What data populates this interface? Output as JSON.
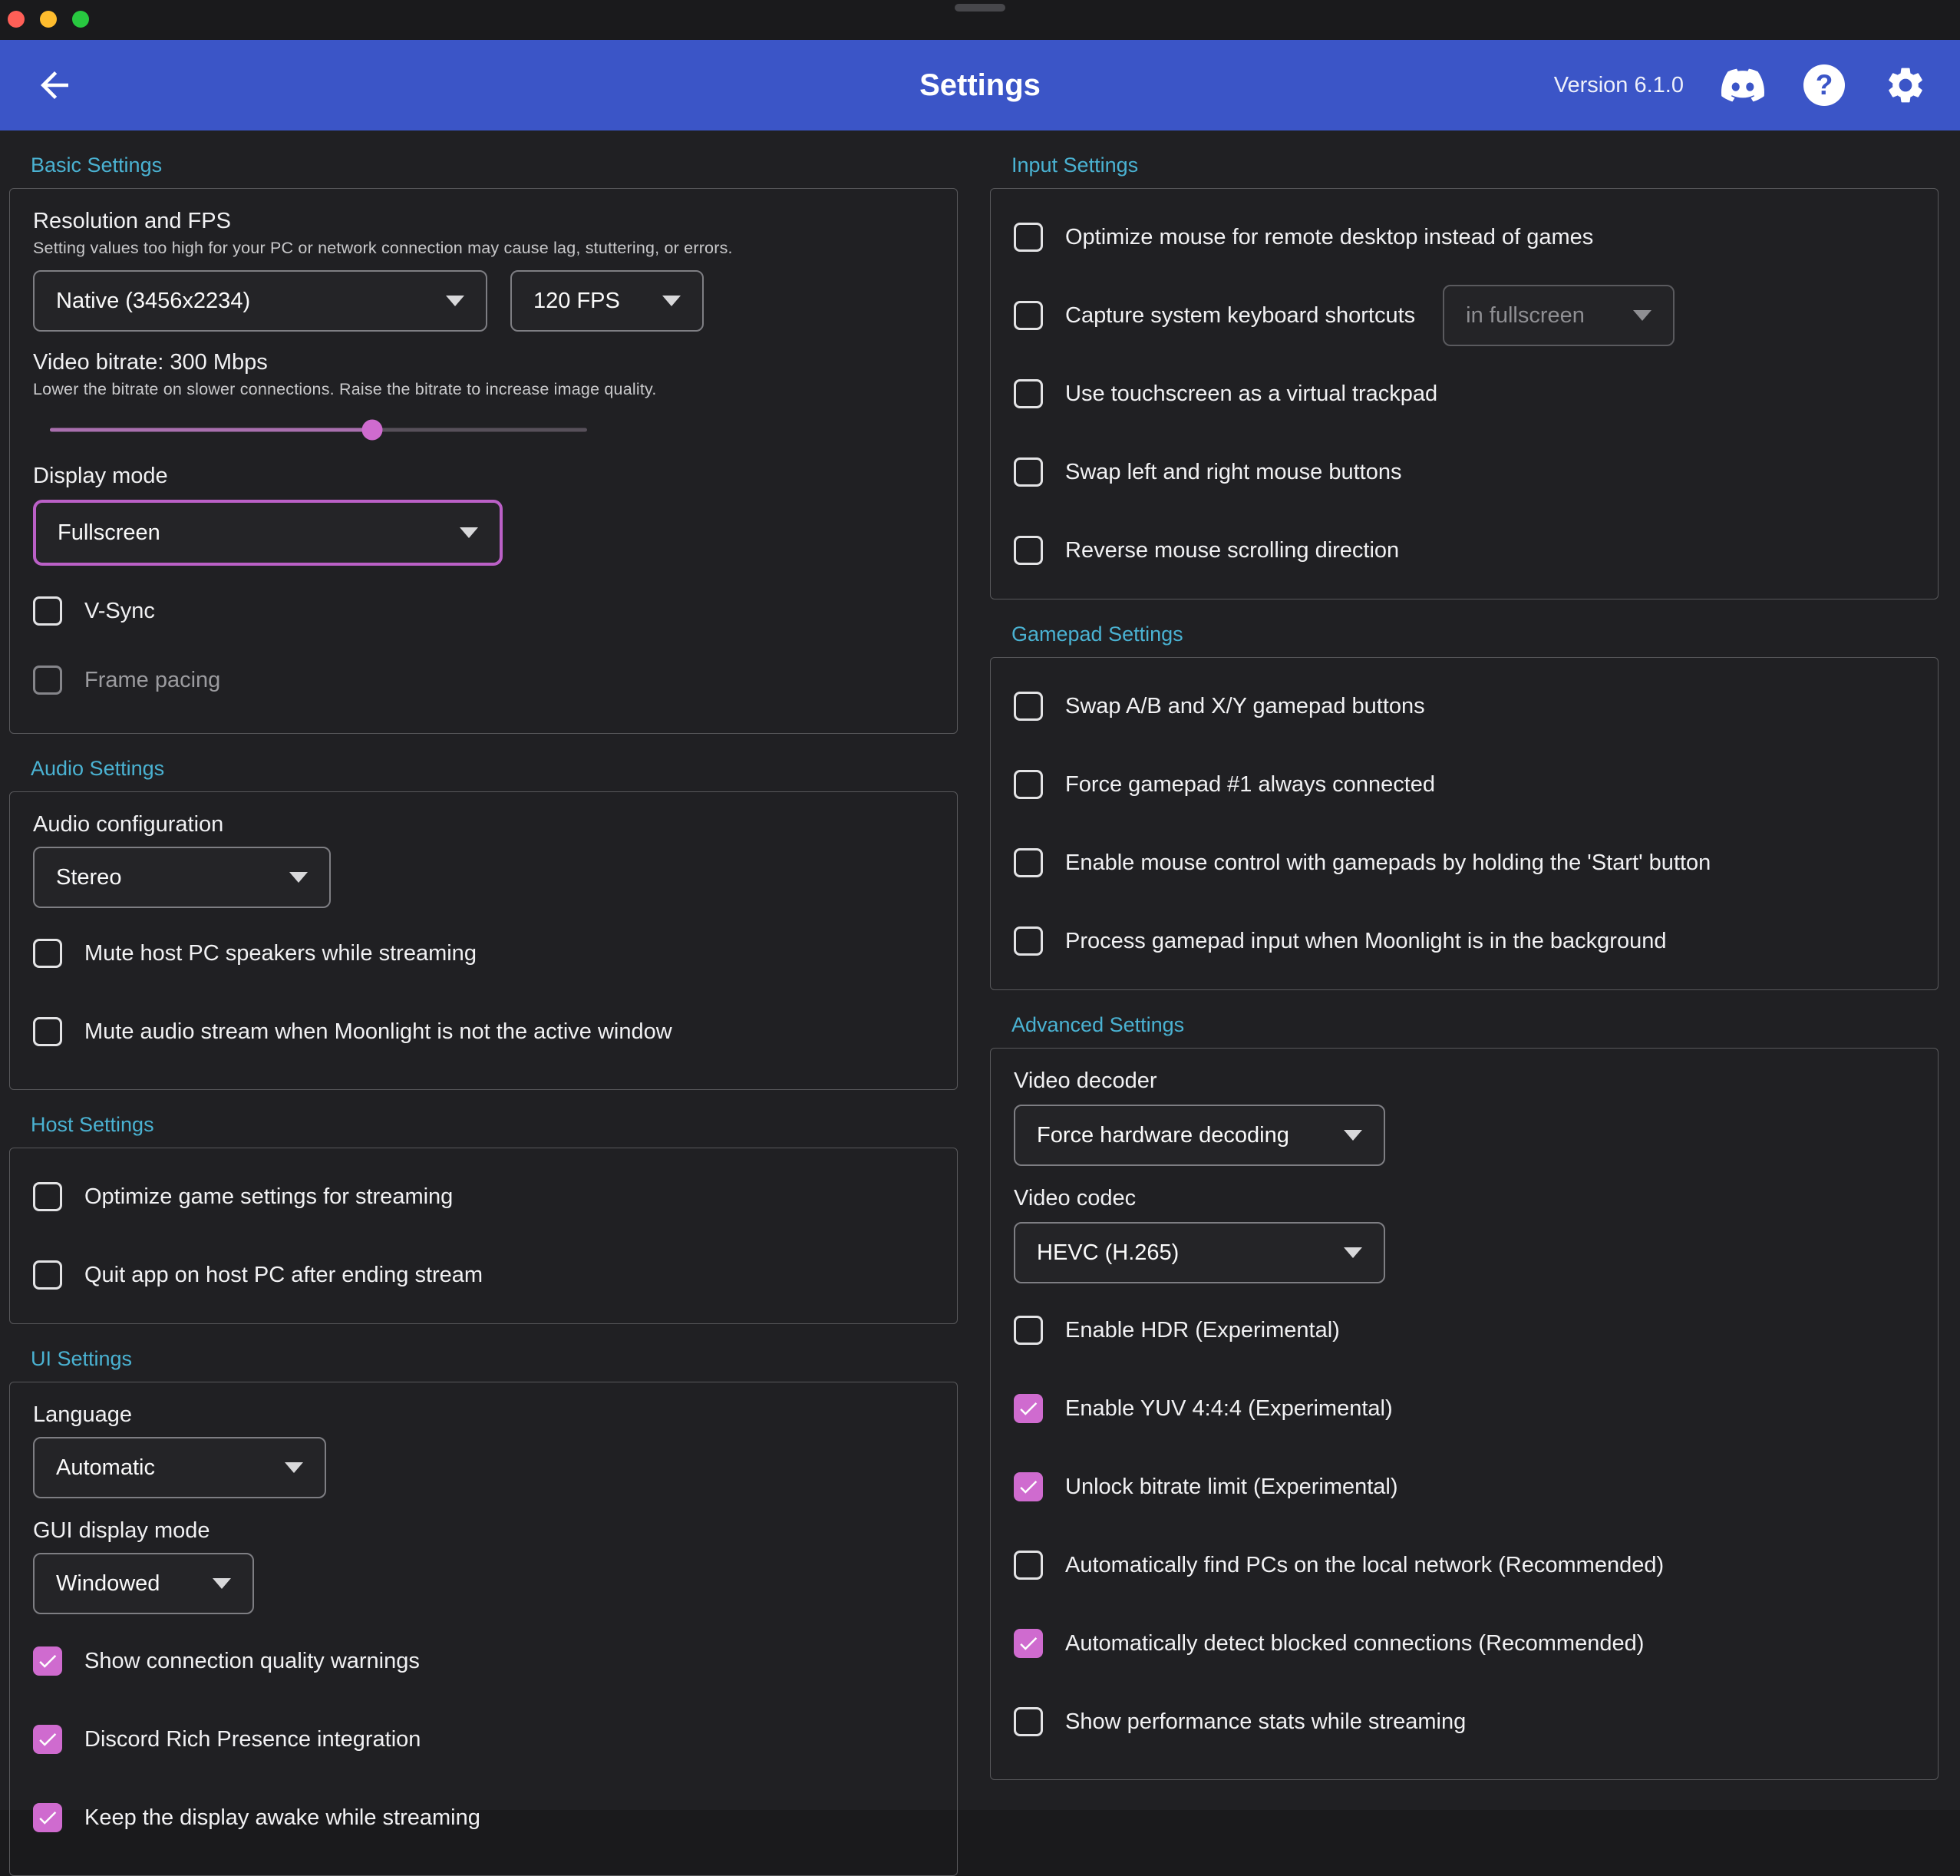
{
  "colors": {
    "accent": "#cf6bcf",
    "header_blue": "#3b55c7",
    "section_heading": "#4ab2d2",
    "focus_ring": "#bb60c7",
    "traffic_red": "#ff5f57",
    "traffic_yellow": "#febc2e",
    "traffic_green": "#28c840"
  },
  "icons": {
    "back": "arrow-left",
    "discord": "discord-logo",
    "help": "question-mark-circle",
    "settings": "gear",
    "dropdown": "chevron-down",
    "check": "checkmark"
  },
  "header": {
    "title": "Settings",
    "version": "Version 6.1.0",
    "help_glyph": "?"
  },
  "basic": {
    "heading": "Basic Settings",
    "resolution_fps_label": "Resolution and FPS",
    "resolution_fps_hint": "Setting values too high for your PC or network connection may cause lag, stuttering, or errors.",
    "resolution_value": "Native (3456x2234)",
    "fps_value": "120 FPS",
    "bitrate_label": "Video bitrate: 300 Mbps",
    "bitrate_hint": "Lower the bitrate on slower connections. Raise the bitrate to increase image quality.",
    "bitrate_percent": 60,
    "display_mode_label": "Display mode",
    "display_mode_value": "Fullscreen",
    "vsync": {
      "label": "V-Sync",
      "checked": false
    },
    "frame_pacing": {
      "label": "Frame pacing",
      "checked": false,
      "disabled": true
    }
  },
  "audio": {
    "heading": "Audio Settings",
    "config_label": "Audio configuration",
    "config_value": "Stereo",
    "mute_host": {
      "label": "Mute host PC speakers while streaming",
      "checked": false
    },
    "mute_inactive": {
      "label": "Mute audio stream when Moonlight is not the active window",
      "checked": false
    }
  },
  "host": {
    "heading": "Host Settings",
    "optimize_game": {
      "label": "Optimize game settings for streaming",
      "checked": false
    },
    "quit_app": {
      "label": "Quit app on host PC after ending stream",
      "checked": false
    }
  },
  "ui": {
    "heading": "UI Settings",
    "language_label": "Language",
    "language_value": "Automatic",
    "gui_mode_label": "GUI display mode",
    "gui_mode_value": "Windowed",
    "quality_warnings": {
      "label": "Show connection quality warnings",
      "checked": true
    },
    "discord_presence": {
      "label": "Discord Rich Presence integration",
      "checked": true
    },
    "keep_awake": {
      "label": "Keep the display awake while streaming",
      "checked": true
    }
  },
  "input": {
    "heading": "Input Settings",
    "optimize_mouse": {
      "label": "Optimize mouse for remote desktop instead of games",
      "checked": false
    },
    "capture_shortcuts": {
      "label": "Capture system keyboard shortcuts",
      "checked": false,
      "mode_value": "in fullscreen",
      "mode_disabled": true
    },
    "touchscreen": {
      "label": "Use touchscreen as a virtual trackpad",
      "checked": false
    },
    "swap_mouse": {
      "label": "Swap left and right mouse buttons",
      "checked": false
    },
    "reverse_scroll": {
      "label": "Reverse mouse scrolling direction",
      "checked": false
    }
  },
  "gamepad": {
    "heading": "Gamepad Settings",
    "swap_ab": {
      "label": "Swap A/B and X/Y gamepad buttons",
      "checked": false
    },
    "force_gamepad": {
      "label": "Force gamepad #1 always connected",
      "checked": false
    },
    "mouse_control": {
      "label": "Enable mouse control with gamepads by holding the 'Start' button",
      "checked": false
    },
    "background_input": {
      "label": "Process gamepad input when Moonlight is in the background",
      "checked": false
    }
  },
  "advanced": {
    "heading": "Advanced Settings",
    "decoder_label": "Video decoder",
    "decoder_value": "Force hardware decoding",
    "codec_label": "Video codec",
    "codec_value": "HEVC (H.265)",
    "hdr": {
      "label": "Enable HDR (Experimental)",
      "checked": false
    },
    "yuv444": {
      "label": "Enable YUV 4:4:4 (Experimental)",
      "checked": true
    },
    "unlock_bitrate": {
      "label": "Unlock bitrate limit (Experimental)",
      "checked": true
    },
    "find_pcs": {
      "label": "Automatically find PCs on the local network (Recommended)",
      "checked": false
    },
    "detect_blocked": {
      "label": "Automatically detect blocked connections (Recommended)",
      "checked": true
    },
    "perf_stats": {
      "label": "Show performance stats while streaming",
      "checked": false
    }
  }
}
